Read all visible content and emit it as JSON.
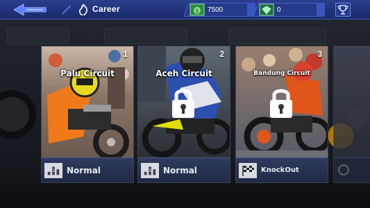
{
  "header": {
    "title": "Career",
    "cash": "7500",
    "gems": "0",
    "back_icon": "back-arrow-icon",
    "title_icon": "fire-icon",
    "trophy_icon": "trophy-icon"
  },
  "tracks": [
    {
      "number": "1",
      "name": "Palu Circuit",
      "mode": "Normal",
      "mode_icon": "rank-bars-icon",
      "locked": false,
      "accent": "#f07a1a"
    },
    {
      "number": "2",
      "name": "Aceh Circuit",
      "mode": "Normal",
      "mode_icon": "rank-bars-icon",
      "locked": true,
      "accent": "#2d4fb0"
    },
    {
      "number": "3",
      "name": "Bandung Circuit",
      "mode": "KnockOut",
      "mode_icon": "checkered-flag-icon",
      "locked": true,
      "accent": "#e0561a"
    }
  ],
  "colors": {
    "topbar": "#1f3380",
    "card_bottom": "#253050",
    "accent_blue": "#4b66cf"
  }
}
